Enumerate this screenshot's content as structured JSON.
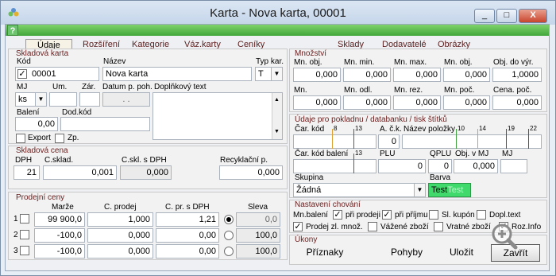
{
  "window": {
    "title": "Karta - Nova karta, 00001",
    "min": "_",
    "max": "□",
    "close": "X"
  },
  "help": "?",
  "tabs": [
    "Údaje",
    "Rozšíření",
    "Kategorie",
    "Váz.karty",
    "Ceníky",
    "Sklady",
    "Dodavatelé",
    "Obrázky"
  ],
  "skladova_karta": {
    "title": "Skladová karta",
    "kod_label": "Kód",
    "kod_value": "00001",
    "nazev_label": "Název",
    "nazev_value": "Nova karta",
    "typ_label": "Typ kar.",
    "typ_value": "T",
    "mj_label": "MJ",
    "um_label": "Um.",
    "zar_label": "Zár.",
    "datum_label": "Datum p. poh.",
    "datum_value": ". .",
    "doplnkovy_label": "Doplňkový text",
    "mj_value": "ks",
    "baleni_label": "Balení",
    "baleni_value": "0,00",
    "dodkod_label": "Dod.kód",
    "export_label": "Export",
    "zp_label": "Zp."
  },
  "skladova_cena": {
    "title": "Skladová cena",
    "dph_label": "DPH",
    "dph_value": "21",
    "cskl_label": "C.sklad.",
    "cskl_value": "0,001",
    "csklsdph_label": "C.skl. s DPH",
    "csklsdph_value": "0,000",
    "recyk_label": "Recyklační p.",
    "recyk_value": "0,000"
  },
  "prodejni_ceny": {
    "title": "Prodejní ceny",
    "h_marze": "Marže",
    "h_cprodej": "C. prodej",
    "h_cprsdph": "C. pr. s DPH",
    "h_sleva": "Sleva",
    "rows": [
      {
        "n": "1",
        "marze": "99 900,0",
        "cprodej": "1,000",
        "cprsdph": "1,21",
        "sleva": "0,0"
      },
      {
        "n": "2",
        "marze": "-100,0",
        "cprodej": "0,000",
        "cprsdph": "0,00",
        "sleva": "100,0"
      },
      {
        "n": "3",
        "marze": "-100,0",
        "cprodej": "0,000",
        "cprsdph": "0,00",
        "sleva": "100,0"
      }
    ]
  },
  "mnozstvi": {
    "title": "Množství",
    "r1": [
      {
        "l": "Mn. obj.",
        "v": "0,000"
      },
      {
        "l": "Mn. min.",
        "v": "0,000"
      },
      {
        "l": "Mn. max.",
        "v": "0,000"
      },
      {
        "l": "Mn. obj.",
        "v": "0,000"
      },
      {
        "l": "Obj. do výr.",
        "v": "1,0000"
      }
    ],
    "r2": [
      {
        "l": "Mn.",
        "v": "0,000"
      },
      {
        "l": "Mn. odl.",
        "v": "0,000"
      },
      {
        "l": "Mn. rez.",
        "v": "0,000"
      },
      {
        "l": "Mn. poč.",
        "v": "0,000"
      },
      {
        "l": "Cena. poč.",
        "v": "0,000"
      }
    ]
  },
  "pokladna": {
    "title": "Údaje pro pokladnu / databanku / tisk štítků",
    "carkod_label": "Čar. kód",
    "ack_label": "A. č.k.",
    "ack_value": "0",
    "nazevpol_label": "Název položky",
    "m8": "8",
    "m13": "13",
    "m10": "10",
    "m14": "14",
    "m19": "19",
    "m22": "22",
    "m13b": "13",
    "carkodbal_label": "Čar. kód balení",
    "plu_label": "PLU",
    "plu_value": "0",
    "qplu_label": "QPLU",
    "qplu_value": "0",
    "objvmj_label": "Obj. v MJ",
    "objvmj_value": "0,000",
    "mj_label": "MJ",
    "skupina_label": "Skupina",
    "skupina_value": "Žádná",
    "barva_label": "Barva",
    "barva_test1": "Test",
    "barva_test2": "Test"
  },
  "nastaveni": {
    "title": "Nastavení chování",
    "mnbaleni": "Mn.balení",
    "priprodeji": "při prodeji",
    "priprijmu": "při příjmu",
    "slkupon": "Sl. kupón",
    "dopltext": "Dopl.text",
    "prodejzl": "Prodej zl. množ.",
    "vazene": "Vážené zboží",
    "vratne": "Vratné zboží",
    "rozinfo": "Roz.Info"
  },
  "ukony": {
    "title": "Úkony",
    "priznaky": "Příznaky",
    "pohyby": "Pohyby",
    "ulozit": "Uložit",
    "zavrit": "Zavřít"
  },
  "colors": {
    "titlebar": "#c5d6ea",
    "help_green": "#41a63b",
    "section_title": "#6a1c1c",
    "barva_green": "#3fd96c"
  }
}
